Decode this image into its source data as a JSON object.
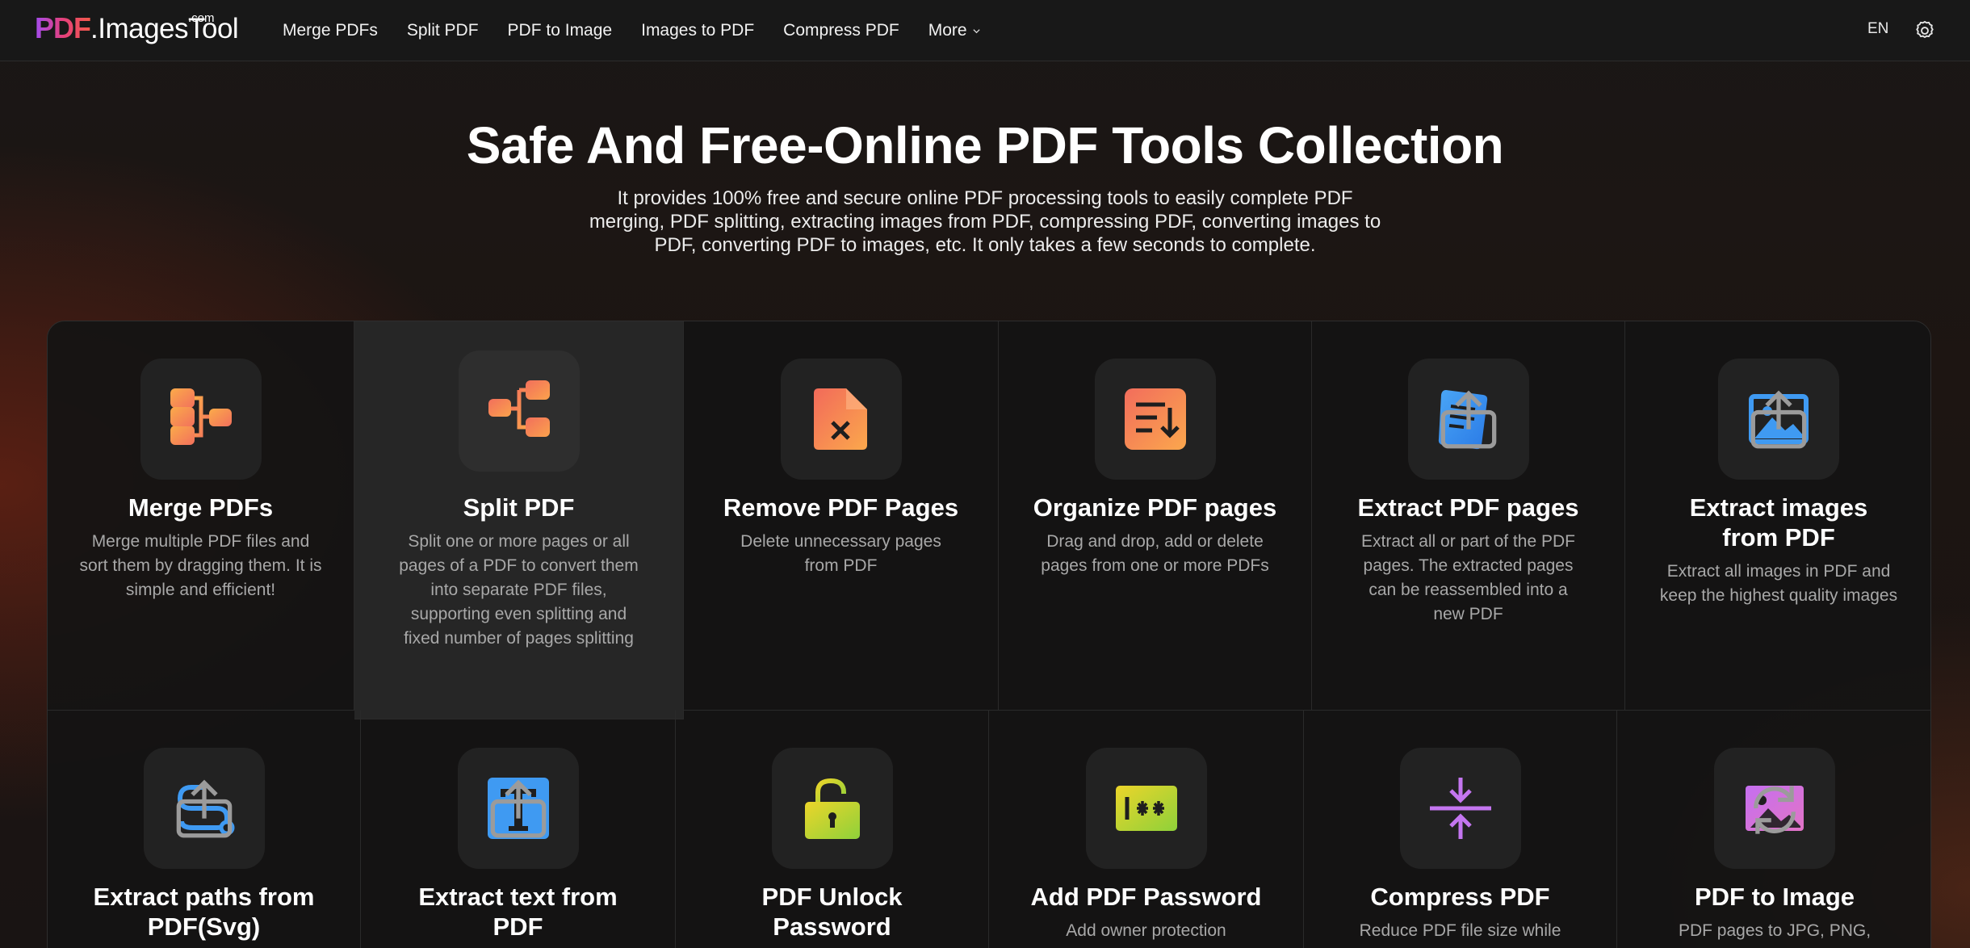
{
  "header": {
    "logo": {
      "pdf": "PDF",
      "rest": ".ImagesTool",
      "com": ".com"
    },
    "nav": [
      {
        "label": "Merge PDFs"
      },
      {
        "label": "Split PDF"
      },
      {
        "label": "PDF to Image"
      },
      {
        "label": "Images to PDF"
      },
      {
        "label": "Compress PDF"
      },
      {
        "label": "More"
      }
    ],
    "lang": "EN",
    "settings_icon": "gear-icon"
  },
  "hero": {
    "title": "Safe And Free-Online PDF Tools Collection",
    "subtitle": "It provides 100% free and secure online PDF processing tools to easily complete PDF merging, PDF splitting, extracting images from PDF, compressing PDF, converting images to PDF, converting PDF to images, etc. It only takes a few seconds to complete."
  },
  "tools": [
    {
      "title": "Merge PDFs",
      "desc": "Merge multiple PDF files and sort them by dragging them. It is simple and efficient!",
      "icon": "merge-icon",
      "active": false
    },
    {
      "title": "Split PDF",
      "desc": "Split one or more pages or all pages of a PDF to convert them into separate PDF files, supporting even splitting and fixed number of pages splitting",
      "icon": "split-icon",
      "active": true
    },
    {
      "title": "Remove PDF Pages",
      "desc": "Delete unnecessary pages from PDF",
      "icon": "remove-page-icon",
      "active": false
    },
    {
      "title": "Organize PDF pages",
      "desc": "Drag and drop, add or delete pages from one or more PDFs",
      "icon": "organize-icon",
      "active": false
    },
    {
      "title": "Extract PDF pages",
      "desc": "Extract all or part of the PDF pages. The extracted pages can be reassembled into a new PDF",
      "icon": "extract-pages-icon",
      "active": false
    },
    {
      "title": "Extract images from PDF",
      "desc": "Extract all images in PDF and keep the highest quality images",
      "icon": "extract-images-icon",
      "active": false
    },
    {
      "title": "Extract paths from PDF(Svg)",
      "desc": "",
      "icon": "extract-paths-icon",
      "active": false
    },
    {
      "title": "Extract text from PDF",
      "desc": "",
      "icon": "extract-text-icon",
      "active": false
    },
    {
      "title": "PDF Unlock Password",
      "desc": "",
      "icon": "unlock-icon",
      "active": false
    },
    {
      "title": "Add PDF Password",
      "desc": "Add owner protection",
      "icon": "password-icon",
      "active": false
    },
    {
      "title": "Compress PDF",
      "desc": "Reduce PDF file size while",
      "icon": "compress-icon",
      "active": false
    },
    {
      "title": "PDF to Image",
      "desc": "PDF pages to JPG, PNG,",
      "icon": "pdf-to-image-icon",
      "active": false
    }
  ]
}
